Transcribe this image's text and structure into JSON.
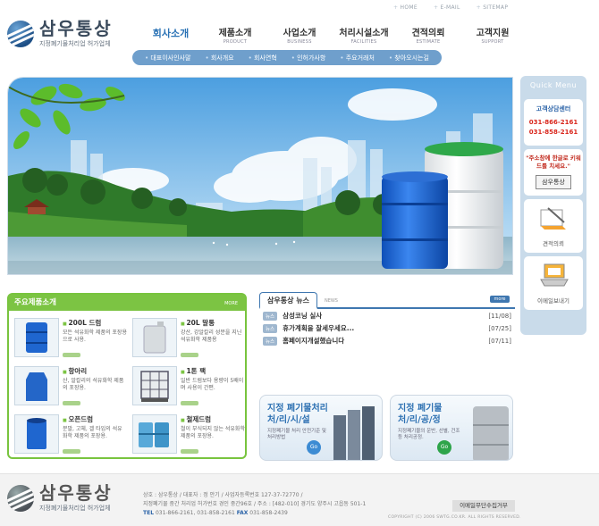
{
  "util_links": [
    "HOME",
    "E-MAIL",
    "SITEMAP"
  ],
  "logo": {
    "title": "삼우통상",
    "subtitle": "지정폐기물처리업 허가업체"
  },
  "gnb": [
    {
      "ko": "회사소개",
      "en": ""
    },
    {
      "ko": "제품소개",
      "en": "PRODUCT"
    },
    {
      "ko": "사업소개",
      "en": "BUSINESS"
    },
    {
      "ko": "처리시설소개",
      "en": "FACILITIES"
    },
    {
      "ko": "견적의뢰",
      "en": "ESTIMATE"
    },
    {
      "ko": "고객지원",
      "en": "SUPPORT"
    }
  ],
  "subnav": [
    "대표이사인사말",
    "회사개요",
    "회사연혁",
    "인허가사항",
    "주요거래처",
    "찾아오시는길"
  ],
  "quick": {
    "title": "Quick Menu",
    "center_label": "고객상담센터",
    "phones": [
      "031-866-2161",
      "031-858-2161"
    ],
    "keyword_note": "\"주소창에 한글로 키워드를 치세요.\"",
    "keyword": "삼우통상",
    "estimate_label": "견적의뢰",
    "email_label": "이메일보내기"
  },
  "products": {
    "title": "주요제품소개",
    "more": "MORE",
    "items": [
      {
        "name": "200L 드럼",
        "desc": "모든 석유화학 제품의 포장용으로 사용."
      },
      {
        "name": "20L 말통",
        "desc": "강산, 강알칼리 성분을 지닌 석유화학 제품용"
      },
      {
        "name": "항아리",
        "desc": "산, 알칼리의 석유화학 제품의 포장용."
      },
      {
        "name": "1톤 팩",
        "desc": "일반 드럼보다 용량이 5배이며 사용이 간편."
      },
      {
        "name": "오픈드럼",
        "desc": "분말, 고체, 겔 타입의 석유화학 제품의 포장용."
      },
      {
        "name": "철제드럼",
        "desc": "철이 부식되지 않는 석유화학 제품의 포장용."
      }
    ]
  },
  "news": {
    "tab_active": "삼우통상 뉴스",
    "tab_other": "NEWS",
    "more": "more",
    "badge": "뉴스",
    "items": [
      {
        "title": "삼성코닝 실사",
        "date": "[11/08]"
      },
      {
        "title": "휴가계획을 잘세우세요...",
        "date": "[07/25]"
      },
      {
        "title": "홈페이지개설했습니다",
        "date": "[07/11]"
      }
    ]
  },
  "promos": [
    {
      "title": "지정 폐기물처리\n처/리/시/설",
      "desc": "지정폐기물 처리 안전기준 및 처리방법",
      "go": "Go"
    },
    {
      "title": "지정 폐기물\n처/리/공/정",
      "desc": "지정폐기물의 운반, 선별, 건조등 처리공정.",
      "go": "Go"
    }
  ],
  "footer": {
    "logo_title": "삼우통상",
    "logo_sub": "지정폐기물처리업 허가업체",
    "line1": "상호 : 삼우통상 / 대표자 : 정 안기 / 사업자등록번호 127-37-72770 /",
    "line2": "지정폐기물 중간 처리업 허가번호 경인 중간96호 / 주소 : [482-010] 경기도 양주시 고읍동 501-1",
    "tel_label": "TEL",
    "tel": "031-866-2161, 031-858-2161",
    "fax_label": "FAX",
    "fax": "031-858-2439",
    "btn": "이메일무단수집거부",
    "copyright": "COPYRIGHT (C) 2006 SWTG.CO.KR. ALL RIGHTS RESERVED."
  },
  "colors": {
    "accent_blue": "#2a72b5",
    "green": "#7cc443",
    "subnav": "#6f9fcc",
    "phone_red": "#d9261c"
  }
}
